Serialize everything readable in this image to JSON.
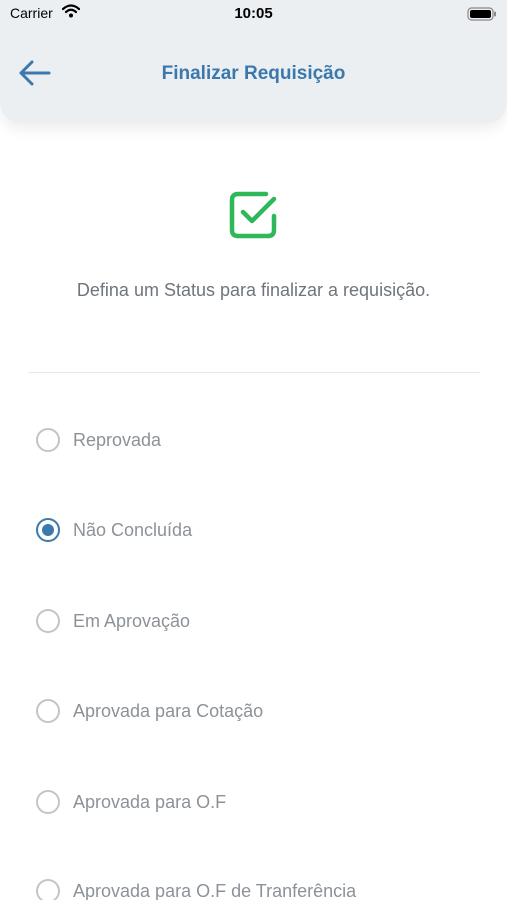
{
  "status_bar": {
    "carrier": "Carrier",
    "time": "10:05"
  },
  "header": {
    "title": "Finalizar Requisição"
  },
  "instruction": "Defina um Status para finalizar a requisição.",
  "colors": {
    "accent": "#3a78ad",
    "success": "#2fb85a",
    "header_bg": "#eceff2"
  },
  "options": [
    {
      "label": "Reprovada",
      "selected": false
    },
    {
      "label": "Não Concluída",
      "selected": true
    },
    {
      "label": "Em Aprovação",
      "selected": false
    },
    {
      "label": "Aprovada para Cotação",
      "selected": false
    },
    {
      "label": "Aprovada para O.F",
      "selected": false
    },
    {
      "label": "Aprovada para O.F de Tranferência",
      "selected": false
    }
  ]
}
